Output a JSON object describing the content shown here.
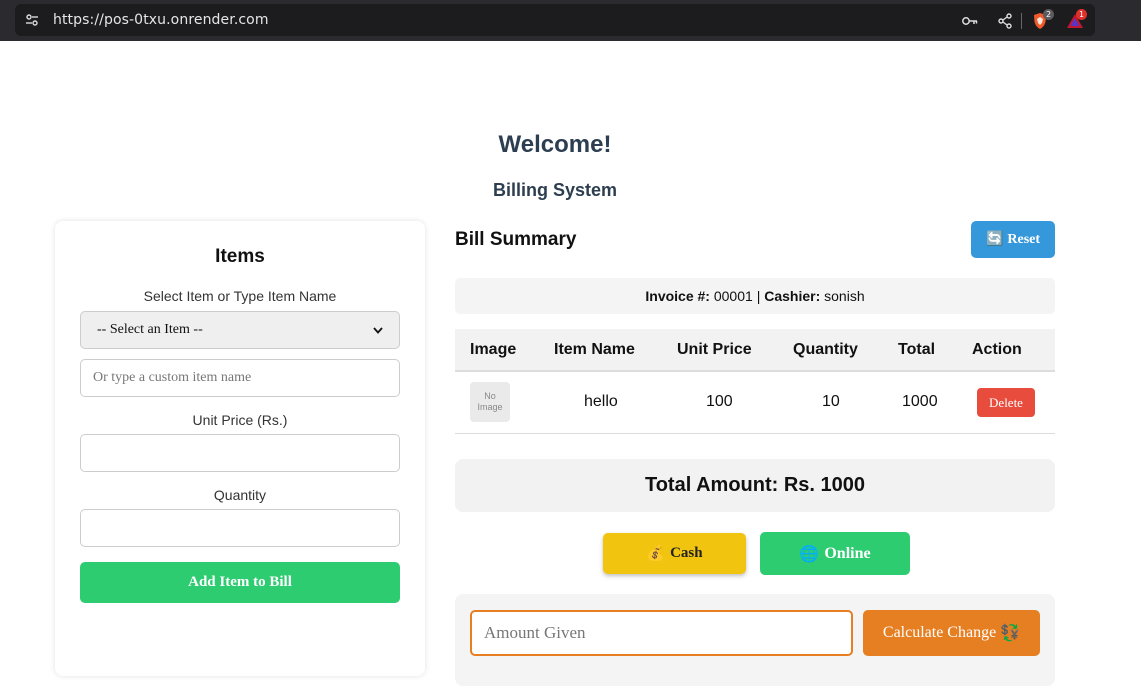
{
  "browser": {
    "url": "https://pos-0txu.onrender.com",
    "brave_badge": "2",
    "rewards_badge": "1"
  },
  "header": {
    "title": "Welcome!",
    "subtitle": "Billing System"
  },
  "items_panel": {
    "title": "Items",
    "select_label": "Select Item or Type Item Name",
    "select_value": "-- Select an Item --",
    "custom_placeholder": "Or type a custom item name",
    "unit_price_label": "Unit Price (Rs.)",
    "quantity_label": "Quantity",
    "add_button": "Add Item to Bill"
  },
  "bill": {
    "title": "Bill Summary",
    "reset_icon": "🔄",
    "reset_label": "Reset",
    "invoice_label": "Invoice #:",
    "invoice_number": "00001",
    "separator": "|",
    "cashier_label": "Cashier:",
    "cashier_name": "sonish",
    "columns": [
      "Image",
      "Item Name",
      "Unit Price",
      "Quantity",
      "Total",
      "Action"
    ],
    "rows": [
      {
        "image_text_1": "No",
        "image_text_2": "Image",
        "name": "hello",
        "unit_price": "100",
        "quantity": "10",
        "total": "1000",
        "action": "Delete"
      }
    ],
    "total_text": "Total Amount: Rs. 1000"
  },
  "payment": {
    "cash_icon": "💰",
    "cash_label": "Cash",
    "online_icon": "🌐",
    "online_label": "Online",
    "amount_placeholder": "Amount Given",
    "calc_label": "Calculate Change",
    "calc_icon": "💱"
  },
  "colors": {
    "green": "#2ecc71",
    "blue": "#3498db",
    "red": "#e74c3c",
    "yellow": "#f1c40f",
    "orange": "#e67e22",
    "heading": "#2c3e50"
  }
}
